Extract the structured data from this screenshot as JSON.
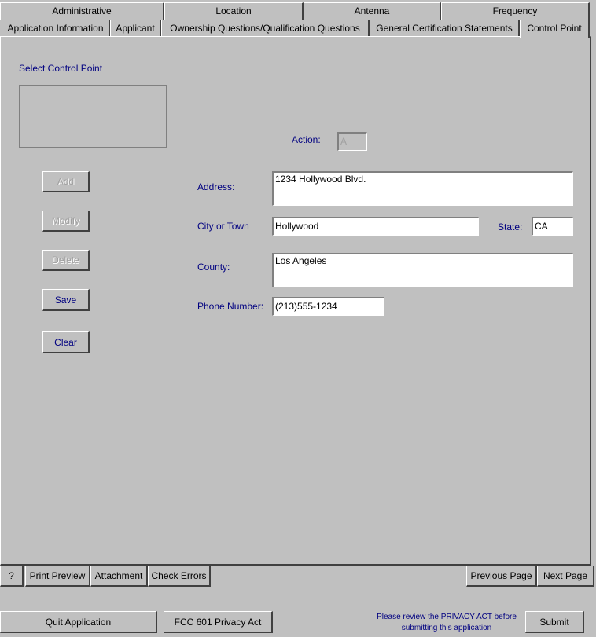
{
  "tabs_top": [
    "Administrative",
    "Location",
    "Antenna",
    "Frequency"
  ],
  "tabs_bottom": [
    "Application Information",
    "Applicant",
    "Ownership Questions/Qualification Questions",
    "General Certification Statements",
    "Control Point"
  ],
  "control_point": {
    "select_label": "Select Control Point",
    "buttons": {
      "add": "Add",
      "modify": "Modify",
      "delete": "Delete",
      "save": "Save",
      "clear": "Clear"
    }
  },
  "form": {
    "action_label": "Action:",
    "action_value": "A",
    "address_label": "Address:",
    "address_value": "1234 Hollywood Blvd.",
    "city_label": "City or Town",
    "city_value": "Hollywood",
    "state_label": "State:",
    "state_value": "CA",
    "county_label": "County:",
    "county_value": "Los Angeles",
    "phone_label": "Phone Number:",
    "phone_value": "(213)555-1234"
  },
  "toolbar": {
    "help": "?",
    "print_preview": "Print Preview",
    "attachment": "Attachment",
    "check_errors": "Check Errors",
    "previous_page": "Previous Page",
    "next_page": "Next Page"
  },
  "footer": {
    "quit": "Quit Application",
    "privacy_act": "FCC 601 Privacy Act",
    "notice_line1": "Please review the PRIVACY ACT before",
    "notice_line2": "submitting this application",
    "submit": "Submit"
  }
}
